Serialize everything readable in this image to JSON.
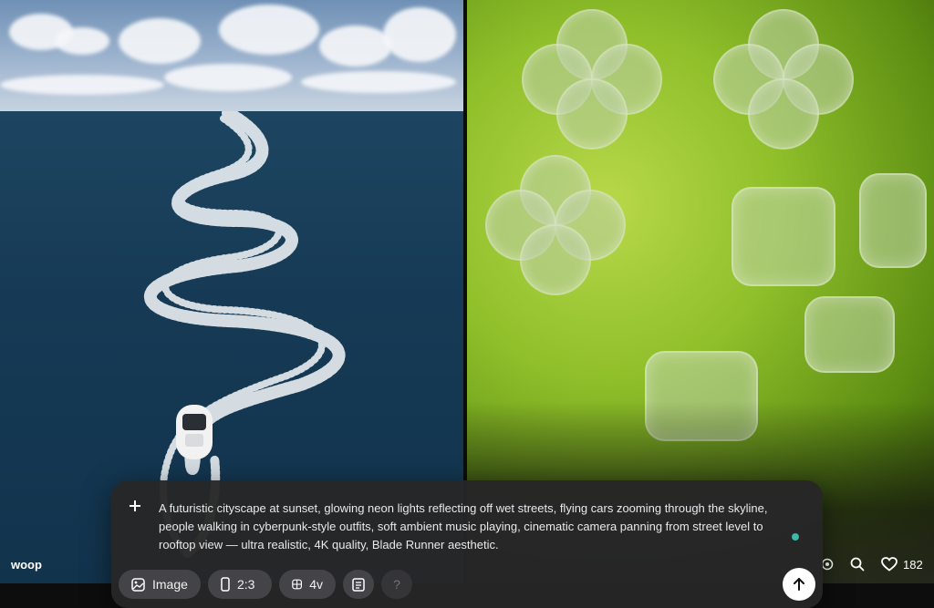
{
  "gallery": {
    "left_tile": {
      "caption": "woop"
    },
    "right_tile": {
      "likes": "182"
    }
  },
  "composer": {
    "prompt": "A futuristic cityscape at sunset, glowing neon lights reflecting off wet streets, flying cars zooming through the skyline, people walking in cyberpunk-style outfits, soft ambient music playing, cinematic camera panning from street level to rooftop view — ultra realistic, 4K quality, Blade Runner aesthetic.",
    "chips": {
      "mode": "Image",
      "aspect": "2:3",
      "variants": "4v",
      "help": "?"
    },
    "icons": {
      "add": "plus-icon",
      "mode": "image-icon",
      "aspect": "phone-portrait-icon",
      "variants": "grid-icon",
      "style": "document-icon",
      "send": "arrow-up-icon"
    },
    "accent_color": "#3bb8a8"
  }
}
